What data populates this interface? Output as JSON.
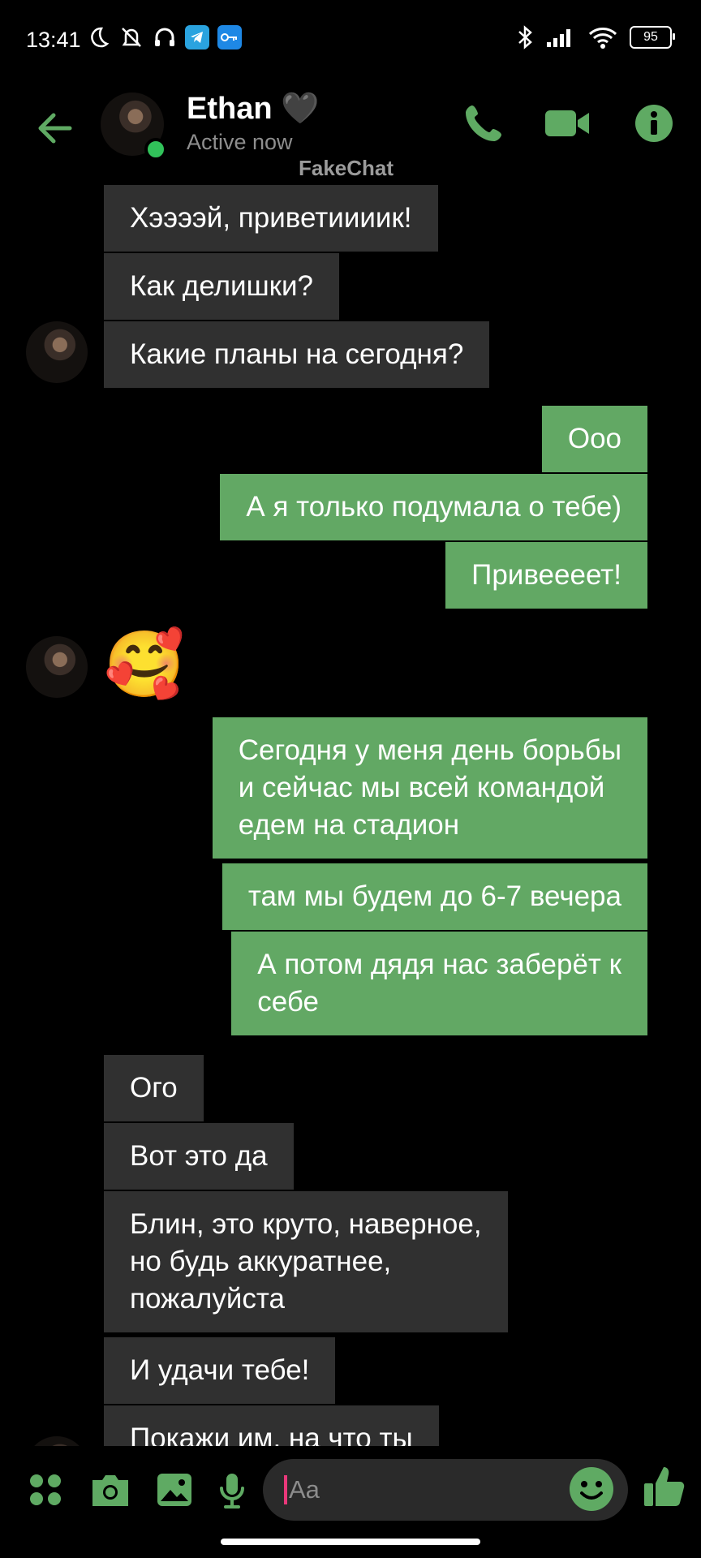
{
  "status_bar": {
    "time": "13:41",
    "battery": "95"
  },
  "header": {
    "contact_name": "Ethan",
    "heart": "🖤",
    "status": "Active now"
  },
  "watermark": "FakeChat",
  "messages": [
    {
      "dir": "in",
      "text": "Хээээй, приветиииик!"
    },
    {
      "dir": "in",
      "text": "Как делишки?"
    },
    {
      "dir": "in",
      "text": "Какие планы на сегодня?"
    },
    {
      "dir": "out",
      "text": "Ооо"
    },
    {
      "dir": "out",
      "text": "А я только подумала о тебе)"
    },
    {
      "dir": "out",
      "text": "Привеееет!"
    },
    {
      "dir": "in",
      "text": "🥰"
    },
    {
      "dir": "out",
      "lines": [
        "Сегодня у меня день борьбы",
        "и сейчас мы всей командой",
        "едем на стадион"
      ]
    },
    {
      "dir": "out",
      "text": "там мы будем до 6-7 вечера"
    },
    {
      "dir": "out",
      "lines": [
        "А потом дядя нас заберёт к",
        "себе"
      ]
    },
    {
      "dir": "in",
      "text": "Ого"
    },
    {
      "dir": "in",
      "text": "Вот это да"
    },
    {
      "dir": "in",
      "lines": [
        "Блин, это круто, наверное,",
        "но будь аккуратнее,",
        "пожалуйста"
      ]
    },
    {
      "dir": "in",
      "text": "И удачи тебе!"
    },
    {
      "dir": "in",
      "text": "Покажи им, на что ты"
    }
  ],
  "composer": {
    "placeholder": "Aa"
  },
  "colors": {
    "accent": "#5faa63",
    "bubble_out": "#62a864",
    "bubble_in": "#303030",
    "background": "#000000"
  }
}
